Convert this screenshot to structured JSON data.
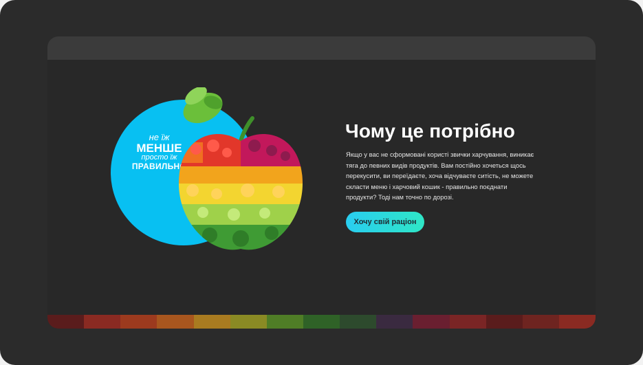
{
  "section": {
    "title": "Чому це потрібно",
    "description": "Якщо у вас не сформовані користі звички харчування, виникає тяга до певних видів продуктів. Вам постійно хочеться щось перекусити, ви переїдаєте, хоча відчуваєте ситість, не можете скласти меню і харчовий кошик - правильно поєднати продукти? Тоді нам точно по дорозі.",
    "cta_label": "Хочу свій раціон"
  },
  "illustration": {
    "slogan": {
      "line1": "не їж",
      "line2": "МЕНШЕ",
      "line3": "просто їж",
      "line4": "ПРАВИЛЬНО"
    },
    "image": "vegetable-apple-illustration"
  },
  "colors": {
    "page_background": "#282828",
    "device_frame": "#2b2b2b",
    "accent_blue": "#08c0f2",
    "button_gradient_start": "#29cdf0",
    "button_gradient_end": "#2fe6c6",
    "title_text": "#ffffff"
  }
}
